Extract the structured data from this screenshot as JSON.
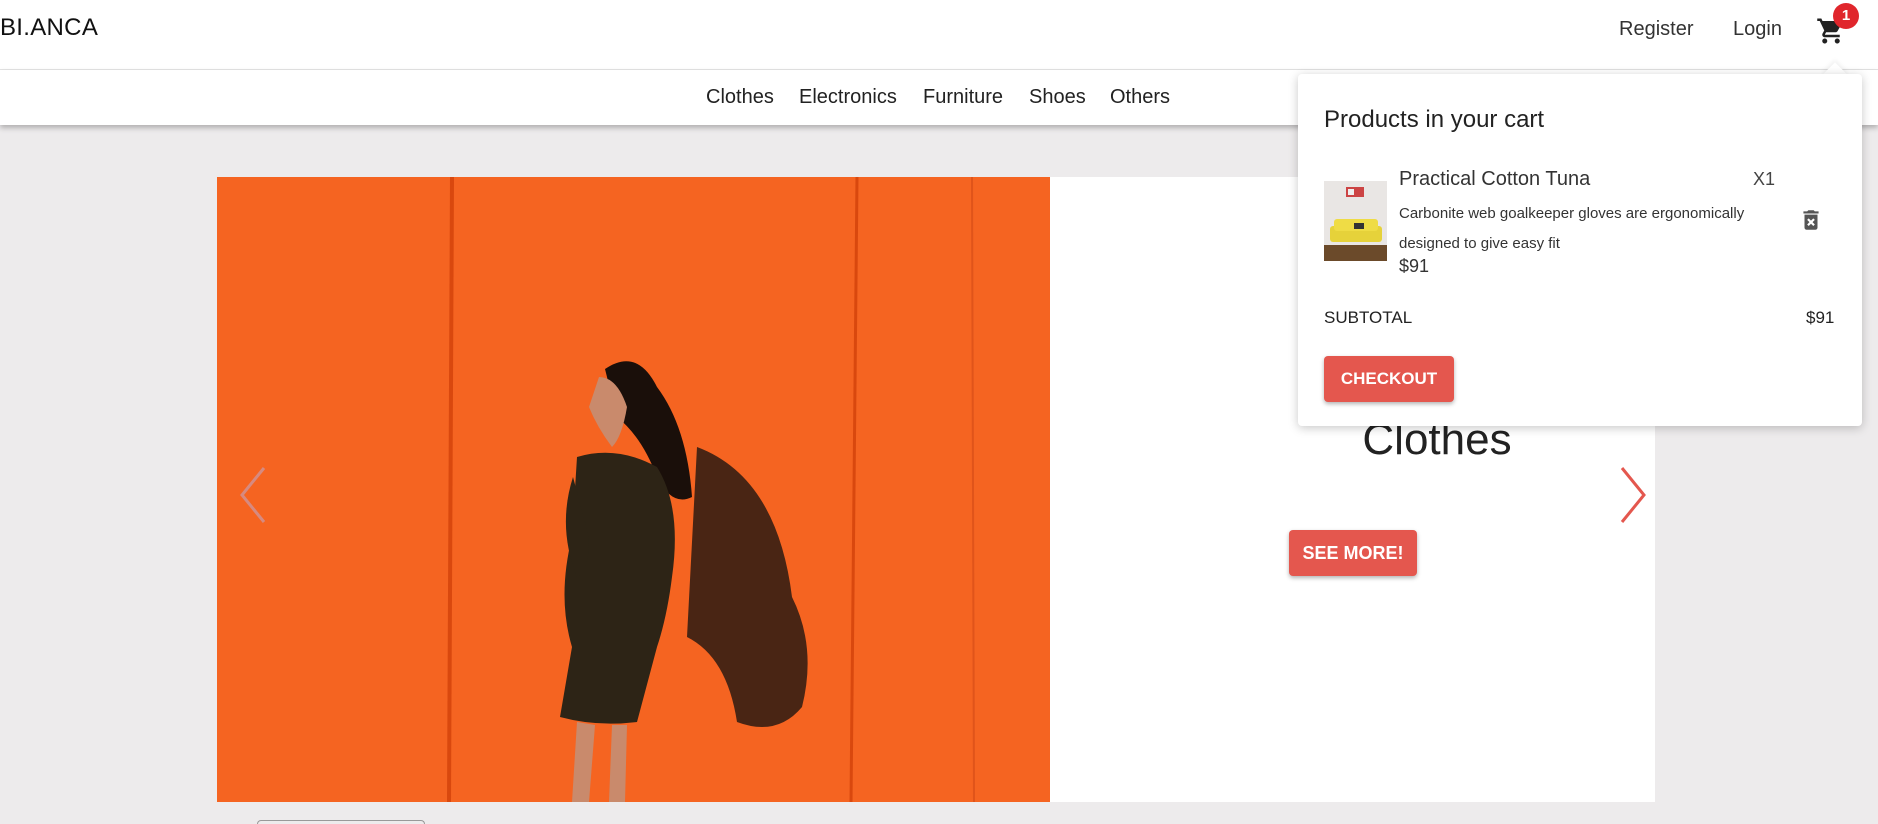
{
  "header": {
    "brand": "BI.ANCA",
    "register_label": "Register",
    "login_label": "Login",
    "cart_count": "1"
  },
  "nav": {
    "items": [
      {
        "label": "Clothes"
      },
      {
        "label": "Electronics"
      },
      {
        "label": "Furniture"
      },
      {
        "label": "Shoes"
      },
      {
        "label": "Others"
      }
    ]
  },
  "carousel": {
    "slide_title": "Clothes",
    "button_label": "SEE MORE!",
    "image_icon": "woman-orange-wall-photo",
    "prev_icon": "chevron-left-icon",
    "next_icon": "chevron-right-icon"
  },
  "cart": {
    "heading": "Products in your cart",
    "items": [
      {
        "name": "Practical Cotton Tuna",
        "quantity": "X1",
        "description": "Carbonite web goalkeeper gloves are ergonomically designed to give easy fit",
        "price": "$91",
        "thumbnail_icon": "yellow-sofa-photo"
      }
    ],
    "subtotal_label": "SUBTOTAL",
    "subtotal_value": "$91",
    "checkout_label": "CHECKOUT"
  },
  "colors": {
    "accent": "#e4574e",
    "badge": "#e0262c",
    "page_background": "#edebec",
    "slide_orange": "#f25c1c"
  }
}
